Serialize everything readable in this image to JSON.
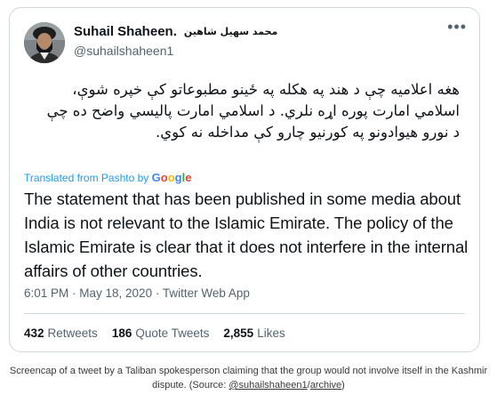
{
  "tweet": {
    "display_name": "Suhail Shaheen.",
    "display_name_native": "محمد سهیل شاهین",
    "handle": "@suhailshaheen1",
    "original_text": "هغه اعلامیه چې د هند په هکله په ځینو مطبوعاتو کې خپره شوې، اسلامي امارت پوره اړه نلري. د اسلامي امارت پالیسي واضح ده چې د نورو هیوادونو په کورنیو چارو کې مداخله نه کوي.",
    "translated_label": "Translated from Pashto by",
    "google_letters": [
      "G",
      "o",
      "o",
      "g",
      "l",
      "e"
    ],
    "translation": "The statement that has been published in some media about India is not relevant to the Islamic Emirate. The policy of the Islamic Emirate is clear that it does not interfere in the internal affairs of other countries.",
    "timestamp": "6:01 PM · May 18, 2020 · Twitter Web App",
    "stats": {
      "retweets_count": "432",
      "retweets_label": "Retweets",
      "quote_tweets_count": "186",
      "quote_tweets_label": "Quote Tweets",
      "likes_count": "2,855",
      "likes_label": "Likes"
    },
    "more_icon": "more-dots-icon",
    "colors": {
      "link_blue": "#1d9bf0",
      "secondary_text": "#536471",
      "border": "#cfd9de"
    }
  },
  "caption": {
    "text_before": "Screencap of a tweet by a Taliban spokesperson claiming that the group would not involve itself in the Kashmir dispute. (Source: ",
    "source_link": "@suhailshaheen1",
    "separator": "/",
    "archive_link": "archive",
    "text_after": ")"
  }
}
